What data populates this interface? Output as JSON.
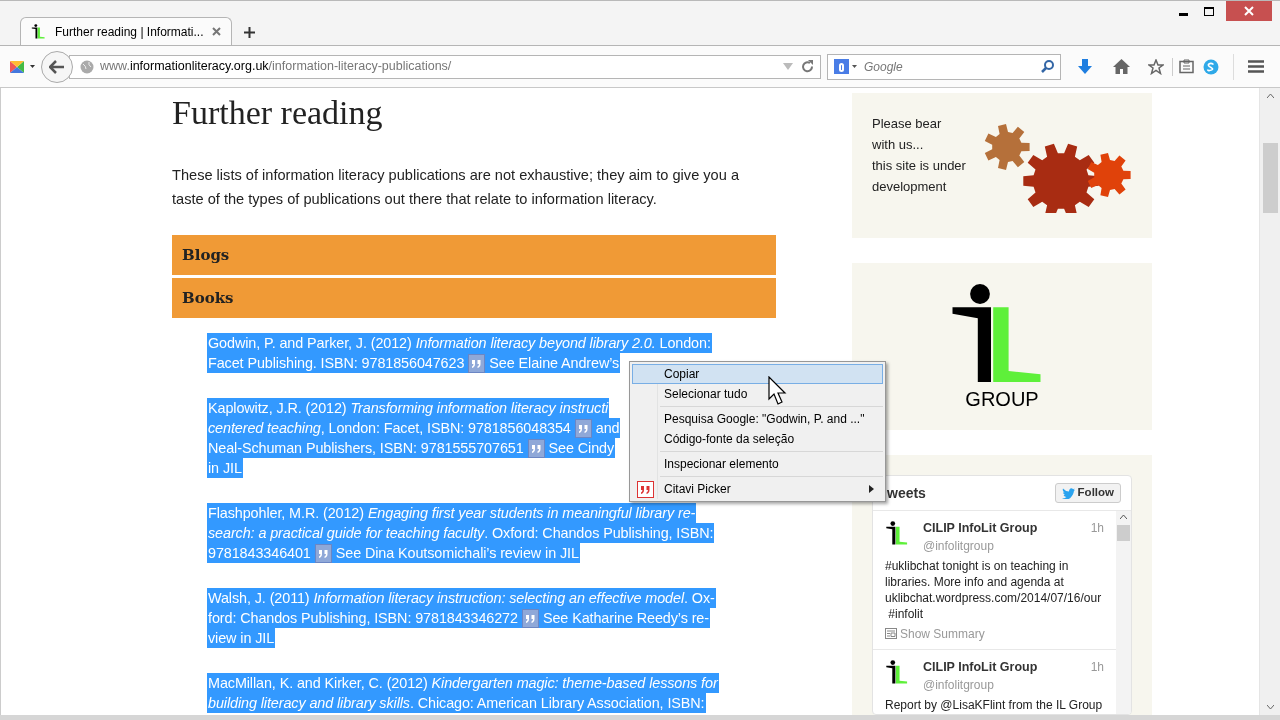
{
  "browser": {
    "tab": {
      "title": "Further reading | Informati...",
      "selected": true
    },
    "url": {
      "prefix": "www.",
      "host": "informationliteracy.org.uk",
      "path": "/information-literacy-publications/"
    },
    "search": {
      "placeholder": "Google"
    }
  },
  "page": {
    "heading": "Further reading",
    "intro": "These lists of information literacy publications are not exhaustive; they aim to give you a taste of the types of publications out there that relate to information literacy.",
    "sections": [
      {
        "label": "Blogs"
      },
      {
        "label": "Books"
      }
    ],
    "entries": [
      {
        "selected": true,
        "lines": [
          [
            {
              "kind": "text",
              "t": "Godwin, P. and Parker, J. (2012) *Information literacy beyond library 2.0.* London:"
            }
          ],
          [
            {
              "kind": "text",
              "t": "Facet Publishing. ISBN: 9781856047623"
            },
            {
              "kind": "quote"
            },
            {
              "kind": "text",
              "t": "See Elaine Andrew’s"
            }
          ]
        ]
      },
      {
        "selected": true,
        "lines": [
          [
            {
              "kind": "text",
              "t": "Kaplowitz, J.R. (2012) *Transforming information literacy instructi*"
            }
          ],
          [
            {
              "kind": "text",
              "t": "*centered teaching*, London: Facet, ISBN: 9781856048354"
            },
            {
              "kind": "quote"
            },
            {
              "kind": "text",
              "t": "and"
            }
          ],
          [
            {
              "kind": "text",
              "t": "Neal-Schuman Publishers, ISBN: 9781555707651"
            },
            {
              "kind": "quote"
            },
            {
              "kind": "text",
              "t": "See Cindy"
            }
          ],
          [
            {
              "kind": "text",
              "t": "in JIL"
            }
          ]
        ]
      },
      {
        "selected": true,
        "lines": [
          [
            {
              "kind": "text",
              "t": "Flashpohler, M.R. (2012) *Engaging first year students in meaningful library re-*"
            }
          ],
          [
            {
              "kind": "text",
              "t": "*search: a practical guide for teaching faculty*. Oxford: Chandos Publishing, ISBN:"
            }
          ],
          [
            {
              "kind": "text",
              "t": "9781843346401"
            },
            {
              "kind": "quote"
            },
            {
              "kind": "text",
              "t": "See Dina Koutsomichali’s review in JIL"
            }
          ]
        ]
      },
      {
        "selected": true,
        "lines": [
          [
            {
              "kind": "text",
              "t": "Walsh, J. (2011) *Information literacy instruction: selecting an effective model*. Ox-"
            }
          ],
          [
            {
              "kind": "text",
              "t": "ford: Chandos Publishing, ISBN: 9781843346272"
            },
            {
              "kind": "quote"
            },
            {
              "kind": "text",
              "t": "See Katharine Reedy’s re-"
            }
          ],
          [
            {
              "kind": "text",
              "t": "view in JIL"
            }
          ]
        ]
      },
      {
        "selected": true,
        "lines": [
          [
            {
              "kind": "text",
              "t": "MacMillan, K. and Kirker, C. (2012) *Kindergarten magic: theme-based lessons for*"
            }
          ],
          [
            {
              "kind": "text",
              "t": "*building literacy and library skills*. Chicago: American Library Association, ISBN:"
            }
          ]
        ]
      }
    ]
  },
  "sidebar": {
    "notice": [
      "Please bear",
      "with us...",
      "this site is under",
      "development"
    ],
    "logo_caption": "GROUP",
    "twitter": {
      "title": "weets",
      "follow": "Follow",
      "tweets": [
        {
          "name": "CILIP InfoLit Group",
          "handle": "@infolitgroup",
          "time": "1h",
          "body": [
            "#uklibchat tonight is on teaching in",
            "libraries. More info and agenda at",
            "uklibchat.wordpress.com/2014/07/16/our",
            " #infolit"
          ],
          "summary": "Show Summary"
        },
        {
          "name": "CILIP InfoLit Group",
          "handle": "@infolitgroup",
          "time": "1h",
          "body": [
            "Report by @LisaKFlint from the IL Group"
          ]
        }
      ]
    }
  },
  "context_menu": {
    "items": [
      {
        "kind": "item",
        "label": "Copiar",
        "selected": true
      },
      {
        "kind": "item",
        "label": "Selecionar tudo",
        "selected": false
      },
      {
        "kind": "separator"
      },
      {
        "kind": "item",
        "label": "Pesquisa Google: \"Godwin, P. and ...\"",
        "selected": false
      },
      {
        "kind": "item",
        "label": "Código-fonte da seleção",
        "selected": false
      },
      {
        "kind": "separator"
      },
      {
        "kind": "item",
        "label": "Inspecionar elemento",
        "selected": false
      },
      {
        "kind": "separator"
      },
      {
        "kind": "submenu",
        "label": "Citavi Picker",
        "selected": false
      }
    ]
  }
}
